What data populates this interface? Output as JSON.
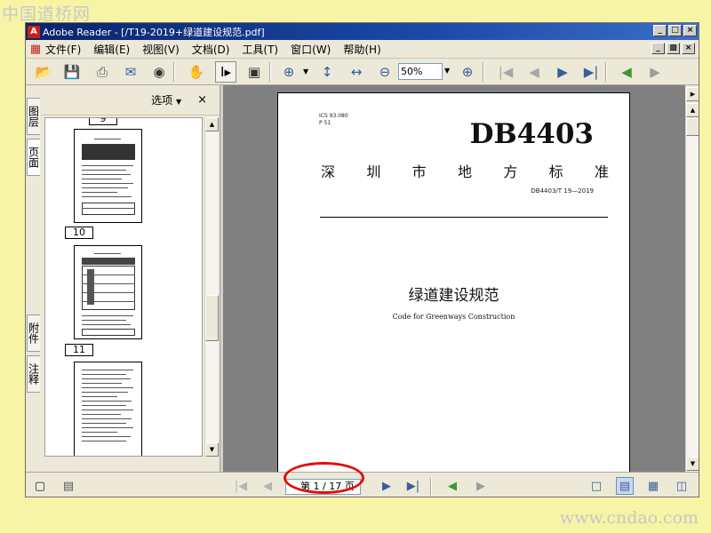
{
  "watermarks": {
    "top": "中国道桥网",
    "bottom": "www.cndao.com"
  },
  "window": {
    "title": "Adobe Reader - [/T19-2019+绿道建设规范.pdf]"
  },
  "menu": [
    "文件(F)",
    "编辑(E)",
    "视图(V)",
    "文档(D)",
    "工具(T)",
    "窗口(W)",
    "帮助(H)"
  ],
  "toolbar": {
    "zoom_value": "50%"
  },
  "side_tabs": [
    "图层",
    "页面",
    "附件",
    "注释"
  ],
  "nav_panel": {
    "options_label": "选项",
    "close_glyph": "×",
    "thumb_labels": [
      "9",
      "10",
      "11"
    ]
  },
  "document": {
    "ics_line1": "ICS 93.080",
    "ics_line2": "P 51",
    "db_code": "DB4403",
    "region_title": [
      "深",
      "圳",
      "市",
      "地",
      "方",
      "标",
      "准"
    ],
    "std_number": "DB4403/T 19—2019",
    "title_zh": "绿道建设规范",
    "title_en": "Code for Greenways Construction"
  },
  "status": {
    "page_indicator": "第 1 / 17 页"
  },
  "colors": {
    "background": "#f7f4a5",
    "titlebar": "#0a246a",
    "highlight_oval": "#e01010"
  }
}
